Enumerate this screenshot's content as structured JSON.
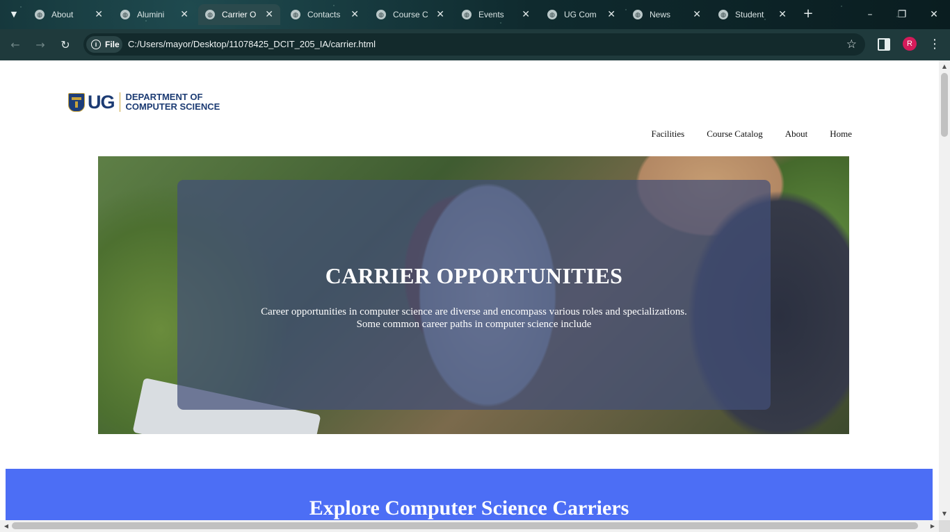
{
  "browser": {
    "tabs": [
      {
        "label": "About",
        "active": false
      },
      {
        "label": "Alumini",
        "active": false
      },
      {
        "label": "Carrier O",
        "active": true
      },
      {
        "label": "Contacts",
        "active": false
      },
      {
        "label": "Course C",
        "active": false
      },
      {
        "label": "Events",
        "active": false
      },
      {
        "label": "UG Com",
        "active": false
      },
      {
        "label": "News",
        "active": false
      },
      {
        "label": "Student",
        "active": false
      }
    ],
    "scheme_chip": "File",
    "url": "C:/Users/mayor/Desktop/11078425_DCIT_205_IA/carrier.html",
    "profile_initial": "R"
  },
  "logo": {
    "short": "UG",
    "dept_line1": "DEPARTMENT OF",
    "dept_line2": "COMPUTER SCIENCE"
  },
  "nav": {
    "items": [
      "Facilities",
      "Course Catalog",
      "About",
      "Home"
    ]
  },
  "hero": {
    "title": "CARRIER OPPORTUNITIES",
    "text_line1": "Career opportunities in computer science are diverse and encompass various roles and specializations.",
    "text_line2": "Some common career paths in computer science include"
  },
  "explore": {
    "title": "Explore Computer Science Carriers"
  },
  "colors": {
    "accent_blue": "#4c6ef5",
    "overlay": "#434f78",
    "logo_navy": "#1c3b73",
    "logo_gold": "#c8a33a",
    "profile_pink": "#d51b5a"
  },
  "icons": [
    "tab-search-icon",
    "globe-icon",
    "close-icon",
    "plus-icon",
    "minimize-icon",
    "restore-icon",
    "back-icon",
    "forward-icon",
    "reload-icon",
    "info-icon",
    "star-icon",
    "side-panel-icon",
    "kebab-menu-icon"
  ]
}
